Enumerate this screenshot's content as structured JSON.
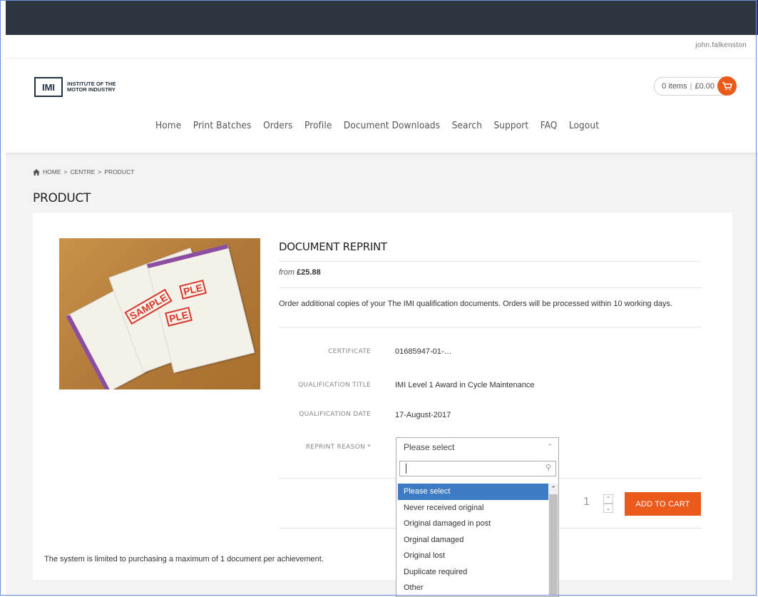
{
  "user": {
    "name": "john.falkenston"
  },
  "brand": {
    "logo_mark": "IMI",
    "line1": "INSTITUTE OF THE",
    "line2": "MOTOR INDUSTRY",
    "accent": "#ea5a1a"
  },
  "cart": {
    "items": "0 items",
    "total": "£0.00"
  },
  "nav": [
    "Home",
    "Print Batches",
    "Orders",
    "Profile",
    "Document Downloads",
    "Search",
    "Support",
    "FAQ",
    "Logout"
  ],
  "breadcrumb": {
    "home": "HOME",
    "sep": ">",
    "centre": "CENTRE",
    "product": "PRODUCT"
  },
  "page": {
    "title": "PRODUCT"
  },
  "product": {
    "title": "DOCUMENT REPRINT",
    "price_prefix": "from",
    "price": "£25.88",
    "description": "Order additional copies of your The IMI qualification documents. Orders will be processed within 10 working days.",
    "image_stamp": "SAMPLE",
    "image_stamp2": "PLE"
  },
  "fields": {
    "certificate": {
      "label": "CERTIFICATE",
      "value": "01685947-01-…"
    },
    "qualification_title": {
      "label": "QUALIFICATION TITLE",
      "value": "IMI Level 1 Award in Cycle Maintenance"
    },
    "qualification_date": {
      "label": "QUALIFICATION DATE",
      "value": "17-August-2017"
    },
    "reprint_reason": {
      "label": "REPRINT REASON *",
      "selected": "Please select"
    }
  },
  "dropdown": {
    "search_placeholder": "",
    "options": [
      "Please select",
      "Never received original",
      "Original damaged in post",
      "Orginal damaged",
      "Original lost",
      "Duplicate required",
      "Other"
    ]
  },
  "quantity": "1",
  "add_to_cart": "ADD TO CART",
  "note": "The system is limited to purchasing a maximum of 1 document per achievement."
}
